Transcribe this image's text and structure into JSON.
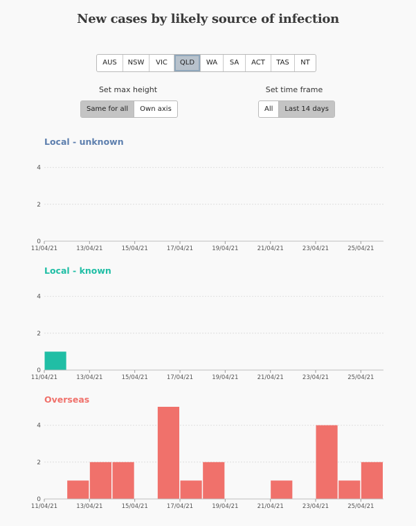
{
  "title": "New cases by likely source of infection",
  "states": [
    "AUS",
    "NSW",
    "VIC",
    "QLD",
    "WA",
    "SA",
    "ACT",
    "TAS",
    "NT"
  ],
  "active_state": "QLD",
  "controls": {
    "max_height_label": "Set max height",
    "max_height_options": [
      "Same for all",
      "Own axis"
    ],
    "max_height_active": "Same for all",
    "time_frame_label": "Set time frame",
    "time_frame_options": [
      "All",
      "Last 14 days"
    ],
    "time_frame_active": "Last 14 days"
  },
  "colors": {
    "local_unknown": "#5d7fae",
    "local_known": "#20bea5",
    "overseas": "#f0716b",
    "grid": "#dedede",
    "axis_text": "#555555"
  },
  "chart_data": [
    {
      "type": "bar",
      "title": "Local - unknown",
      "categories": [
        "11/04/21",
        "12/04/21",
        "13/04/21",
        "14/04/21",
        "15/04/21",
        "16/04/21",
        "17/04/21",
        "18/04/21",
        "19/04/21",
        "20/04/21",
        "21/04/21",
        "22/04/21",
        "23/04/21",
        "24/04/21",
        "25/04/21"
      ],
      "values": [
        0,
        0,
        0,
        0,
        0,
        0,
        0,
        0,
        0,
        0,
        0,
        0,
        0,
        0,
        0
      ],
      "x_tick_labels": [
        "11/04/21",
        "13/04/21",
        "15/04/21",
        "17/04/21",
        "19/04/21",
        "21/04/21",
        "23/04/21",
        "25/04/21"
      ],
      "y_ticks": [
        0,
        2,
        4
      ],
      "ylim": [
        0,
        5
      ],
      "color": "#5d7fae",
      "grid": true
    },
    {
      "type": "bar",
      "title": "Local - known",
      "categories": [
        "11/04/21",
        "12/04/21",
        "13/04/21",
        "14/04/21",
        "15/04/21",
        "16/04/21",
        "17/04/21",
        "18/04/21",
        "19/04/21",
        "20/04/21",
        "21/04/21",
        "22/04/21",
        "23/04/21",
        "24/04/21",
        "25/04/21"
      ],
      "values": [
        1,
        0,
        0,
        0,
        0,
        0,
        0,
        0,
        0,
        0,
        0,
        0,
        0,
        0,
        0
      ],
      "x_tick_labels": [
        "11/04/21",
        "13/04/21",
        "15/04/21",
        "17/04/21",
        "19/04/21",
        "21/04/21",
        "23/04/21",
        "25/04/21"
      ],
      "y_ticks": [
        0,
        2,
        4
      ],
      "ylim": [
        0,
        5
      ],
      "color": "#20bea5",
      "grid": true
    },
    {
      "type": "bar",
      "title": "Overseas",
      "categories": [
        "11/04/21",
        "12/04/21",
        "13/04/21",
        "14/04/21",
        "15/04/21",
        "16/04/21",
        "17/04/21",
        "18/04/21",
        "19/04/21",
        "20/04/21",
        "21/04/21",
        "22/04/21",
        "23/04/21",
        "24/04/21",
        "25/04/21"
      ],
      "values": [
        0,
        1,
        2,
        2,
        0,
        5,
        1,
        2,
        0,
        0,
        1,
        0,
        4,
        1,
        2
      ],
      "x_tick_labels": [
        "11/04/21",
        "13/04/21",
        "15/04/21",
        "17/04/21",
        "19/04/21",
        "21/04/21",
        "23/04/21",
        "25/04/21"
      ],
      "y_ticks": [
        0,
        2,
        4
      ],
      "ylim": [
        0,
        5
      ],
      "color": "#f0716b",
      "grid": true
    }
  ]
}
